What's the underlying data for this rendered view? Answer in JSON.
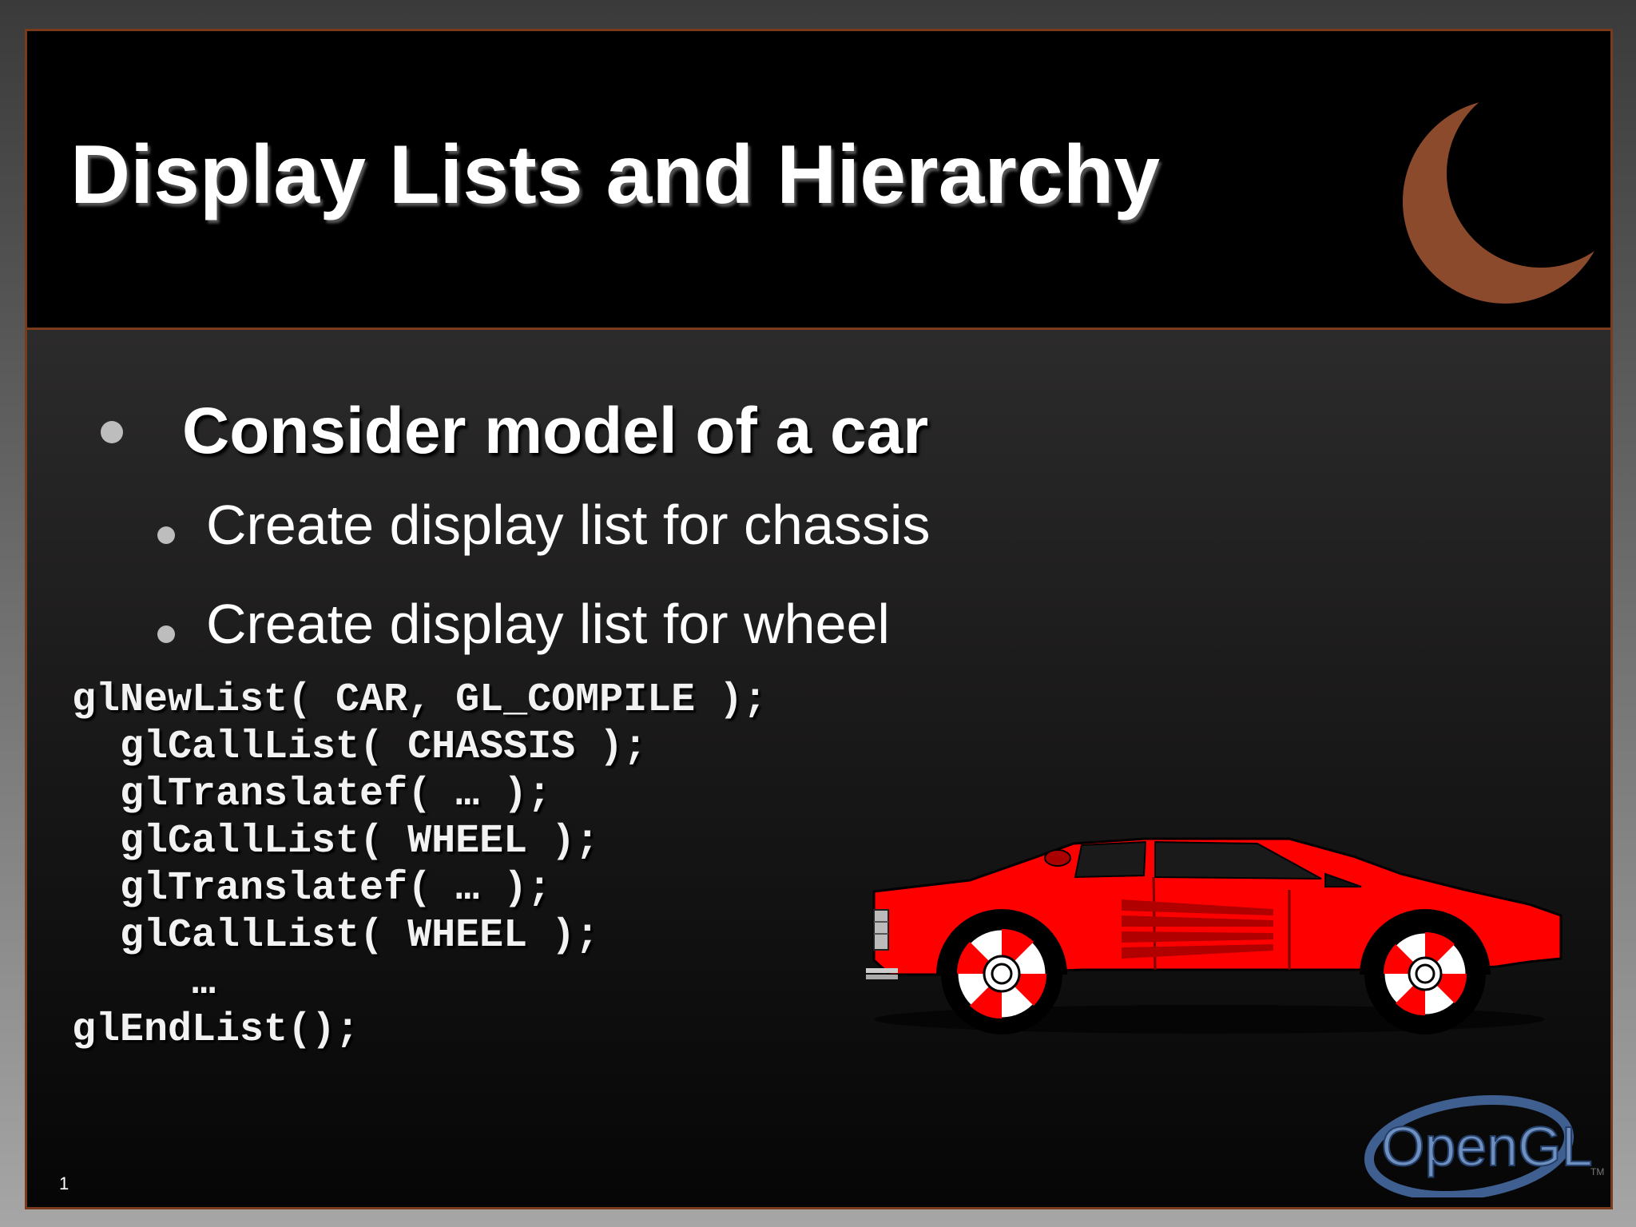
{
  "slide": {
    "title": "Display Lists and Hierarchy",
    "bullets": {
      "main": "Consider model of a car",
      "sub": [
        "Create display list for chassis",
        "Create display list for wheel"
      ]
    },
    "code_lines": [
      "glNewList( CAR, GL_COMPILE );",
      "  glCallList( CHASSIS );",
      "  glTranslatef( … );",
      "  glCallList( WHEEL );",
      "  glTranslatef( … );",
      "  glCallList( WHEEL );",
      "     …",
      "glEndList();"
    ],
    "page_number": "1",
    "logo": {
      "text": "OpenGL",
      "tm": "TM"
    },
    "colors": {
      "border": "#7a3a1c",
      "moon": "#8c4a2c",
      "car": "#ff0000",
      "logo_ring": "#4a6a9a"
    },
    "icons": [
      "crescent-moon-icon",
      "red-sports-car-image",
      "opengl-logo"
    ]
  }
}
